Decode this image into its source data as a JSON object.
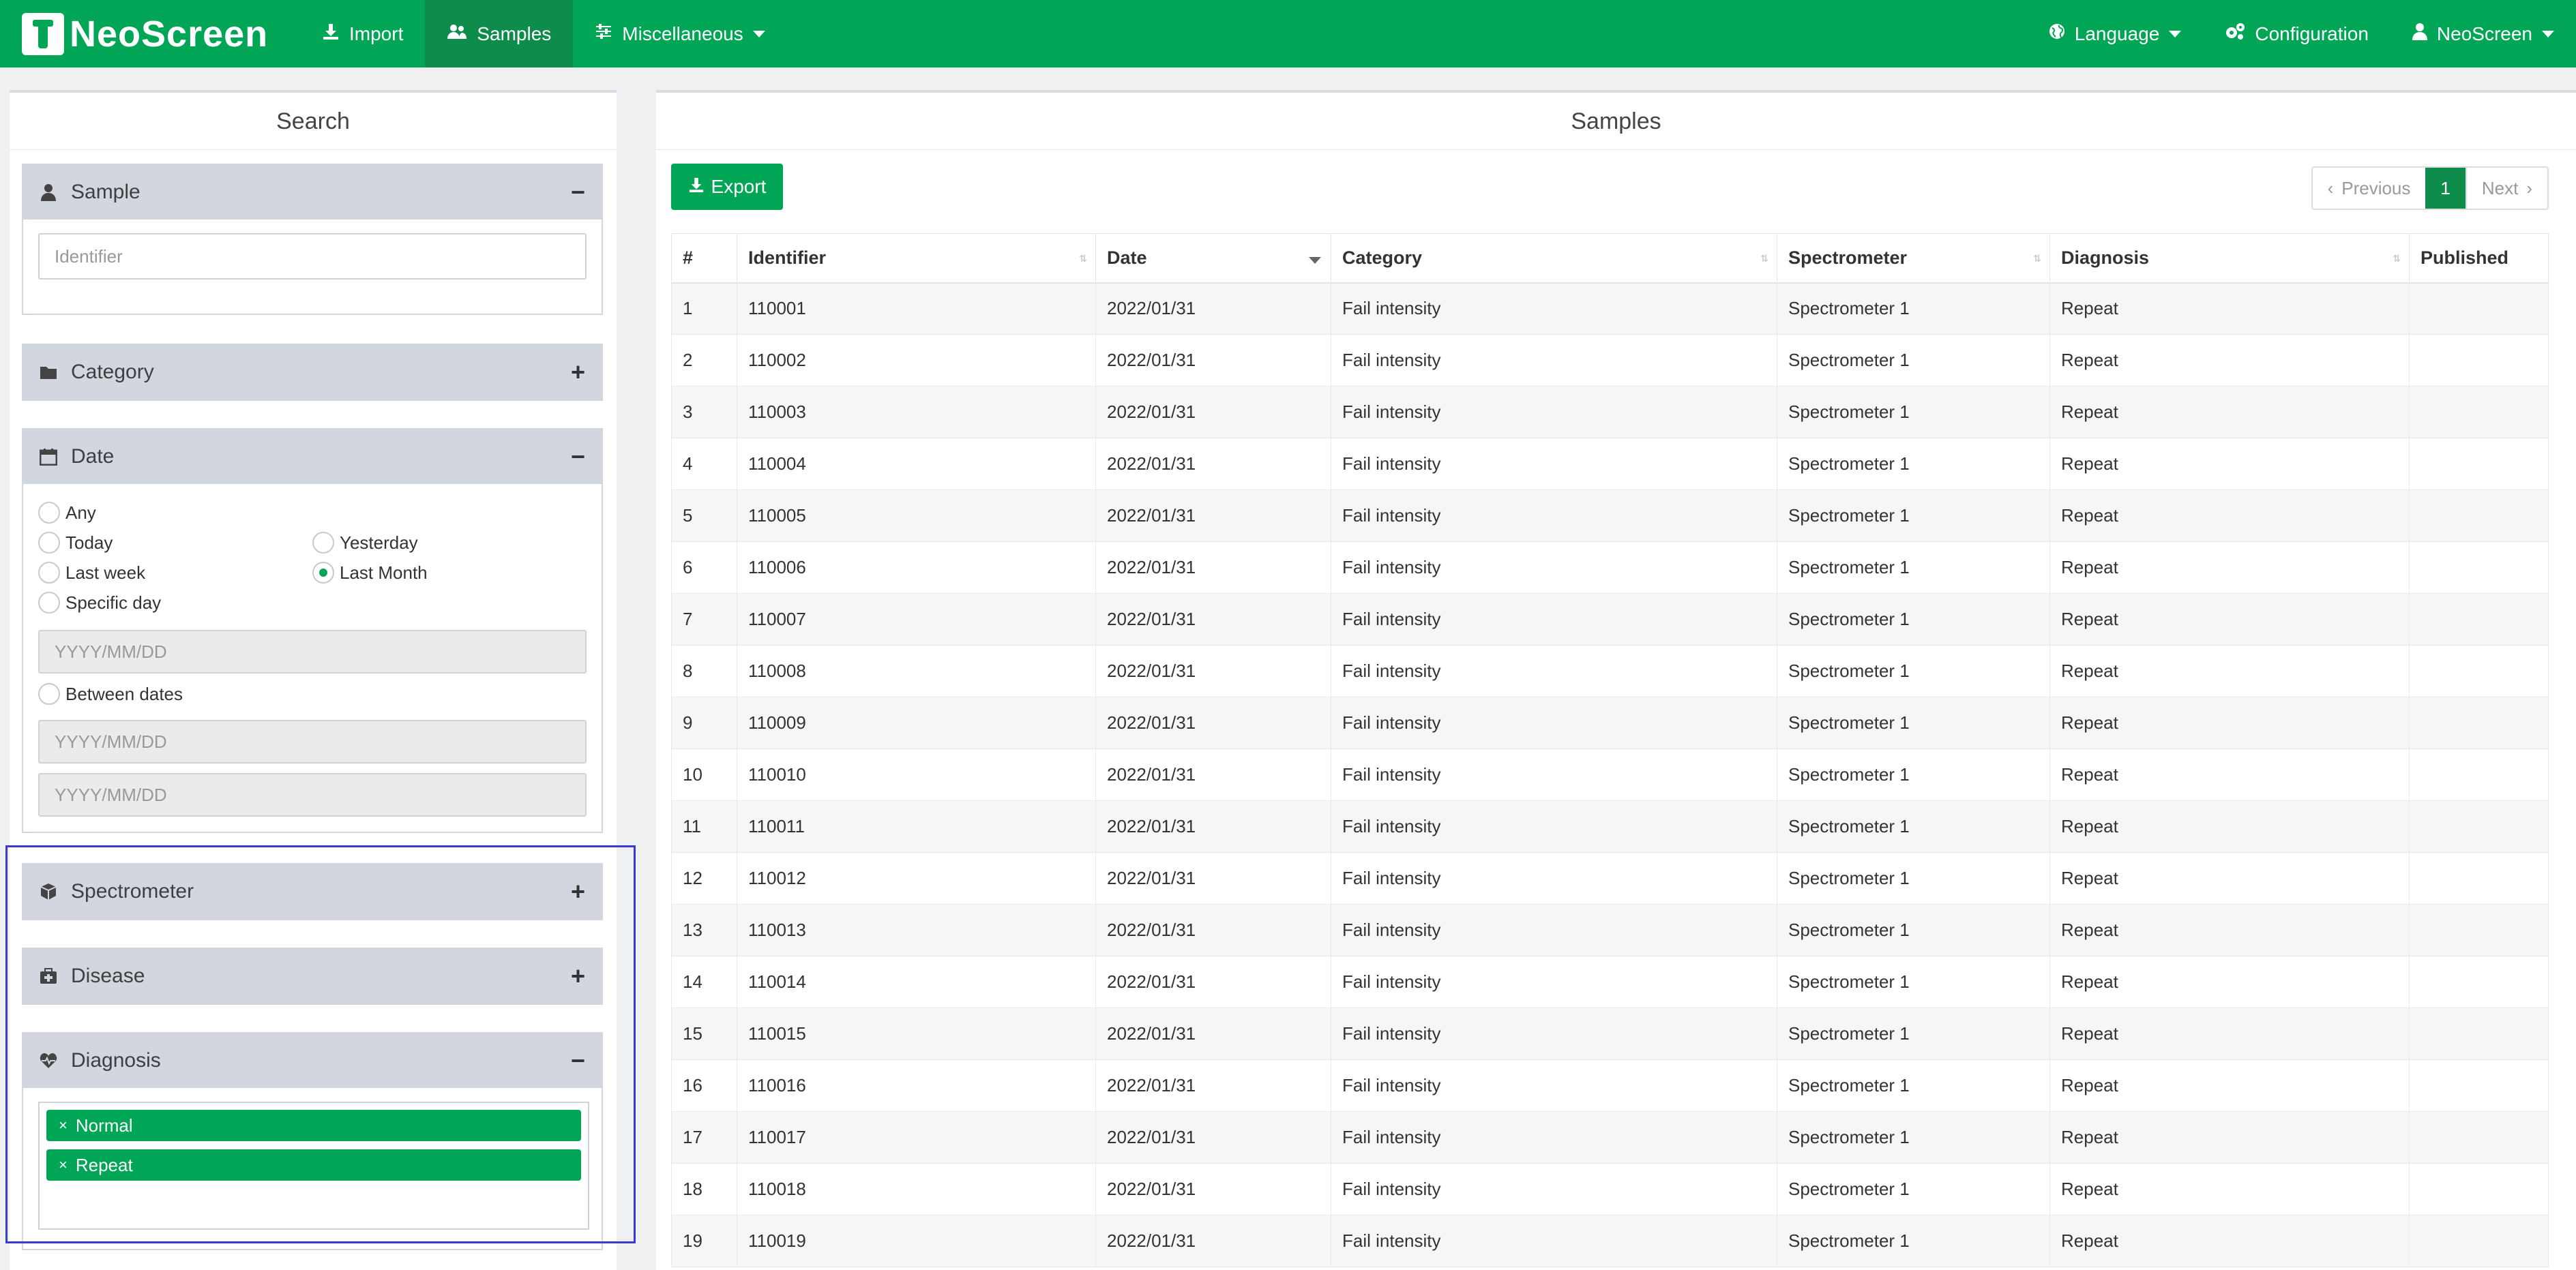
{
  "navbar": {
    "brand": "NeoScreen",
    "items": [
      {
        "label": "Import",
        "icon": "download-icon"
      },
      {
        "label": "Samples",
        "icon": "users-icon"
      },
      {
        "label": "Miscellaneous",
        "icon": "sliders-icon"
      }
    ],
    "right": [
      {
        "label": "Language",
        "icon": "globe-icon"
      },
      {
        "label": "Configuration",
        "icon": "cogs-icon"
      },
      {
        "label": "NeoScreen",
        "icon": "user-icon"
      }
    ]
  },
  "search": {
    "title": "Search",
    "sample": {
      "title": "Sample",
      "toggle": "−",
      "placeholder": "Identifier"
    },
    "category": {
      "title": "Category",
      "toggle": "+"
    },
    "date": {
      "title": "Date",
      "toggle": "−",
      "options": {
        "any": "Any",
        "today": "Today",
        "yesterday": "Yesterday",
        "last_week": "Last week",
        "last_month": "Last Month",
        "specific_day": "Specific day",
        "between": "Between dates"
      },
      "selected": "Last Month",
      "placeholder": "YYYY/MM/DD"
    },
    "spectrometer": {
      "title": "Spectrometer",
      "toggle": "+"
    },
    "disease": {
      "title": "Disease",
      "toggle": "+"
    },
    "diagnosis": {
      "title": "Diagnosis",
      "toggle": "−",
      "tags": [
        "Normal",
        "Repeat"
      ]
    }
  },
  "samples": {
    "title": "Samples",
    "export_label": "Export",
    "pager": {
      "previous": "Previous",
      "current": "1",
      "next": "Next"
    },
    "columns": [
      "#",
      "Identifier",
      "Date",
      "Category",
      "Spectrometer",
      "Diagnosis",
      "Published"
    ],
    "rows": [
      [
        "1",
        "110001",
        "2022/01/31",
        "Fail intensity",
        "Spectrometer 1",
        "Repeat",
        ""
      ],
      [
        "2",
        "110002",
        "2022/01/31",
        "Fail intensity",
        "Spectrometer 1",
        "Repeat",
        ""
      ],
      [
        "3",
        "110003",
        "2022/01/31",
        "Fail intensity",
        "Spectrometer 1",
        "Repeat",
        ""
      ],
      [
        "4",
        "110004",
        "2022/01/31",
        "Fail intensity",
        "Spectrometer 1",
        "Repeat",
        ""
      ],
      [
        "5",
        "110005",
        "2022/01/31",
        "Fail intensity",
        "Spectrometer 1",
        "Repeat",
        ""
      ],
      [
        "6",
        "110006",
        "2022/01/31",
        "Fail intensity",
        "Spectrometer 1",
        "Repeat",
        ""
      ],
      [
        "7",
        "110007",
        "2022/01/31",
        "Fail intensity",
        "Spectrometer 1",
        "Repeat",
        ""
      ],
      [
        "8",
        "110008",
        "2022/01/31",
        "Fail intensity",
        "Spectrometer 1",
        "Repeat",
        ""
      ],
      [
        "9",
        "110009",
        "2022/01/31",
        "Fail intensity",
        "Spectrometer 1",
        "Repeat",
        ""
      ],
      [
        "10",
        "110010",
        "2022/01/31",
        "Fail intensity",
        "Spectrometer 1",
        "Repeat",
        ""
      ],
      [
        "11",
        "110011",
        "2022/01/31",
        "Fail intensity",
        "Spectrometer 1",
        "Repeat",
        ""
      ],
      [
        "12",
        "110012",
        "2022/01/31",
        "Fail intensity",
        "Spectrometer 1",
        "Repeat",
        ""
      ],
      [
        "13",
        "110013",
        "2022/01/31",
        "Fail intensity",
        "Spectrometer 1",
        "Repeat",
        ""
      ],
      [
        "14",
        "110014",
        "2022/01/31",
        "Fail intensity",
        "Spectrometer 1",
        "Repeat",
        ""
      ],
      [
        "15",
        "110015",
        "2022/01/31",
        "Fail intensity",
        "Spectrometer 1",
        "Repeat",
        ""
      ],
      [
        "16",
        "110016",
        "2022/01/31",
        "Fail intensity",
        "Spectrometer 1",
        "Repeat",
        ""
      ],
      [
        "17",
        "110017",
        "2022/01/31",
        "Fail intensity",
        "Spectrometer 1",
        "Repeat",
        ""
      ],
      [
        "18",
        "110018",
        "2022/01/31",
        "Fail intensity",
        "Spectrometer 1",
        "Repeat",
        ""
      ],
      [
        "19",
        "110019",
        "2022/01/31",
        "Fail intensity",
        "Spectrometer 1",
        "Repeat",
        ""
      ]
    ]
  },
  "colors": {
    "brand_green": "#00a556",
    "nav_active": "#0d8c4c",
    "filter_header": "#d2d6de",
    "highlight": "#3a3acb"
  }
}
